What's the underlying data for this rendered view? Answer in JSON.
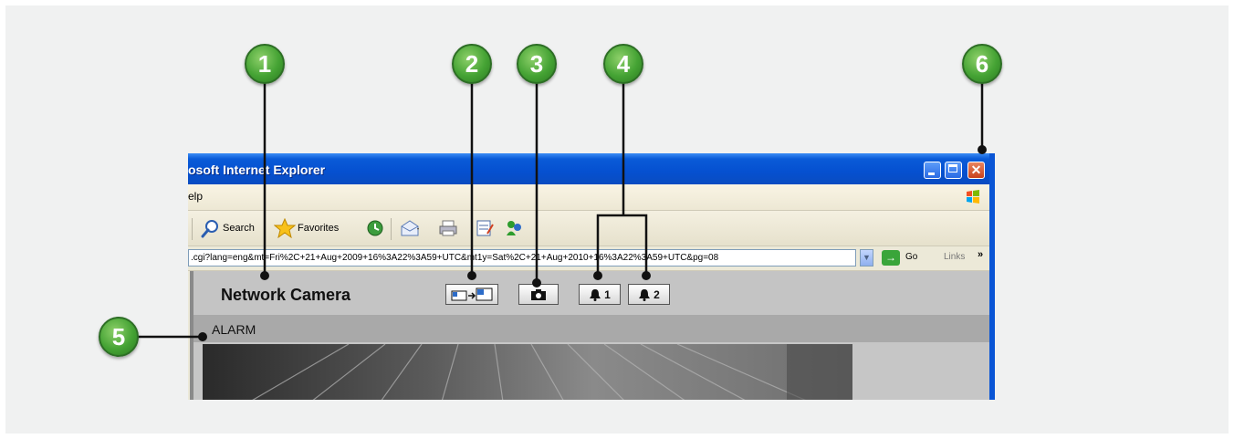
{
  "window": {
    "title": "osoft Internet Explorer",
    "menu_text": "elp"
  },
  "toolbar": {
    "search_label": "Search",
    "favorites_label": "Favorites"
  },
  "address": {
    "url": ".cgi?lang=eng&mt=Fri%2C+21+Aug+2009+16%3A22%3A59+UTC&mt1y=Sat%2C+21+Aug+2010+16%3A22%3A59+UTC&pg=08",
    "go_label": "Go",
    "links_label": "Links",
    "links_chevron": "»"
  },
  "camera": {
    "title": "Network Camera",
    "alarm1_label": "1",
    "alarm2_label": "2",
    "alarm_bar_text": "ALARM"
  },
  "callouts": [
    "1",
    "2",
    "3",
    "4",
    "5",
    "6"
  ],
  "colors": {
    "callout_green": "#45a334",
    "titlebar_blue": "#0550d0",
    "close_red": "#c9411b"
  }
}
